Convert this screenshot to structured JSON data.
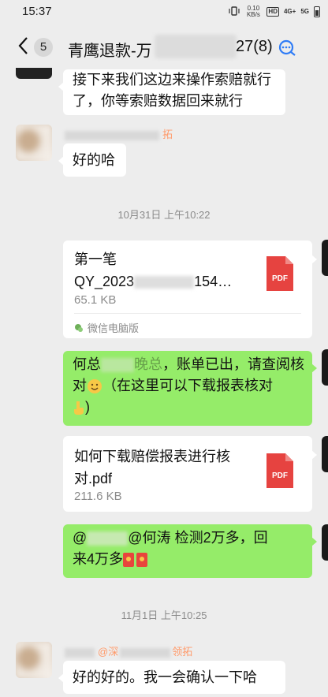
{
  "status_bar": {
    "time": "15:37",
    "net_speed": "0.10 KB/s",
    "hd_label": "HD",
    "signal_1": "4G+",
    "signal_2": "5G"
  },
  "header": {
    "unread_count": "5",
    "title_prefix": "青鹰退款-万",
    "title_suffix": "27(8)"
  },
  "messages": {
    "m1_text_line1": "接下来我们这边来操作索赔就行",
    "m1_text_line2": "了，你等索赔数据回来就行",
    "m2_sender_tag": "拓",
    "m2_text": "好的哈",
    "ts1": "10月31日 上午10:22",
    "file1_name_line1": "第一笔",
    "file1_name_line2": "QY_2023",
    "file1_name_line2_tail": "154…",
    "file1_size": "65.1 KB",
    "file1_source": "微信电脑版",
    "pdf_label": "PDF",
    "m3_line1_a": "何总",
    "m3_line1_b": "晚总",
    "m3_line1_c": "，账单已出，请查阅核",
    "m3_line2_a": "对",
    "m3_line2_b": "（在这里可以下载报表核对",
    "m3_line3": ")",
    "file2_name_line1": "如何下载赔偿报表进行核",
    "file2_name_line2": "对.pdf",
    "file2_size": "211.6 KB",
    "m4_line1_a": "@",
    "m4_line1_b": "@何涛",
    "m4_line1_c": " 检测2万多，回",
    "m4_line2": "来4万多",
    "ts2": "11月1日 上午10:25",
    "m5_sender_a": "@深",
    "m5_sender_b": "领拓",
    "m5_text": "好的好的。我一会确认一下哈"
  },
  "colors": {
    "bg": "#ededed",
    "green_bubble": "#95ec69",
    "pdf_red": "#e64340"
  }
}
